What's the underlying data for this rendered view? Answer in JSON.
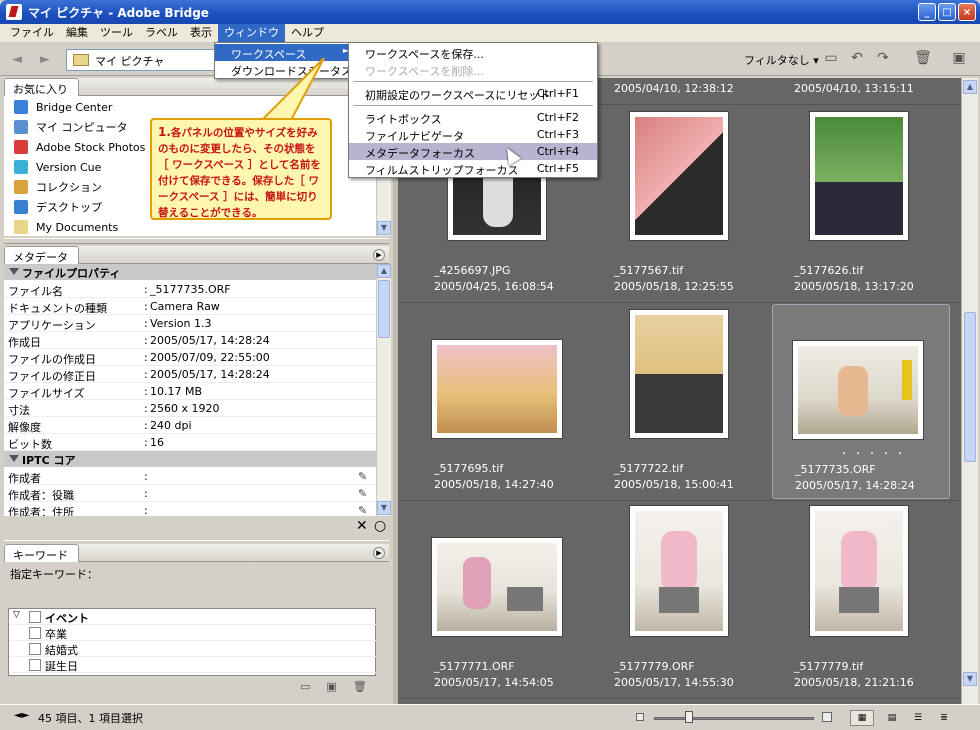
{
  "window": {
    "title": "マイ ピクチャ - Adobe Bridge",
    "min": "_",
    "max": "□",
    "close": "×"
  },
  "menubar": [
    "ファイル",
    "編集",
    "ツール",
    "ラベル",
    "表示",
    "ウィンドウ",
    "ヘルプ"
  ],
  "toolbar": {
    "back": "◄",
    "forward": "►",
    "path": "マイ ピクチャ",
    "filter": "フィルタなし"
  },
  "favorites": {
    "tab": "お気に入り",
    "items": [
      "Bridge Center",
      "マイ コンピュータ",
      "Adobe Stock Photos",
      "Version Cue",
      "コレクション",
      "デスクトップ",
      "My Documents"
    ],
    "colors": [
      "#3a7fd9",
      "#5a8fd0",
      "#d93a3a",
      "#3ab0d9",
      "#d9a23a",
      "#3a80d0",
      "#e8d48a"
    ]
  },
  "metadata": {
    "tab": "メタデータ",
    "section1": "ファイルプロパティ",
    "rows": [
      {
        "k": "ファイル名",
        "v": "_5177735.ORF"
      },
      {
        "k": "ドキュメントの種類",
        "v": "Camera Raw"
      },
      {
        "k": "アプリケーション",
        "v": "Version 1.3"
      },
      {
        "k": "作成日",
        "v": "2005/05/17, 14:28:24"
      },
      {
        "k": "ファイルの作成日",
        "v": "2005/07/09, 22:55:00"
      },
      {
        "k": "ファイルの修正日",
        "v": "2005/05/17, 14:28:24"
      },
      {
        "k": "ファイルサイズ",
        "v": "10.17 MB"
      },
      {
        "k": "寸法",
        "v": "2560 x 1920"
      },
      {
        "k": "解像度",
        "v": "240 dpi"
      },
      {
        "k": "ビット数",
        "v": "16"
      }
    ],
    "section2": "IPTC コア",
    "iptc": [
      "作成者",
      "作成者：役職",
      "作成者：住所"
    ],
    "colon": ":"
  },
  "keywords": {
    "tab": "キーワード",
    "assigned": "指定キーワード：",
    "items": [
      {
        "t": "イベント",
        "bold": true
      },
      {
        "t": "卒業",
        "bold": false
      },
      {
        "t": "結婚式",
        "bold": false
      },
      {
        "t": "誕生日",
        "bold": false
      }
    ]
  },
  "content": {
    "toprow": [
      "2005/04/10, 12:38:12",
      "2005/04/10, 13:15:11"
    ],
    "cells": [
      {
        "name": "_4256697.JPG",
        "date": "2005/04/25, 16:08:54",
        "c": [
          "#222",
          "#ddd"
        ]
      },
      {
        "name": "_5177567.tif",
        "date": "2005/05/18, 12:25:55",
        "c": [
          "#c86a6a",
          "#2a2a2a"
        ]
      },
      {
        "name": "_5177626.tif",
        "date": "2005/05/18, 13:17:20",
        "c": [
          "#4a8a3a",
          "#2a2a3a"
        ]
      },
      {
        "name": "_5177695.tif",
        "date": "2005/05/18, 14:27:40",
        "c": [
          "#e8c07a",
          "#d88aa0"
        ]
      },
      {
        "name": "_5177722.tif",
        "date": "2005/05/18, 15:00:41",
        "c": [
          "#e0c080",
          "#3a3a3a"
        ]
      },
      {
        "name": "_5177735.ORF",
        "date": "2005/05/17, 14:28:24",
        "c": [
          "#ddd8cc",
          "#e8b890"
        ]
      },
      {
        "name": "_5177771.ORF",
        "date": "2005/05/17, 14:54:05",
        "c": [
          "#e8e4dc",
          "#e0a0b8"
        ]
      },
      {
        "name": "_5177779.ORF",
        "date": "2005/05/17, 14:55:30",
        "c": [
          "#ece8e0",
          "#f0b8c8"
        ]
      },
      {
        "name": "_5177779.tif",
        "date": "2005/05/18, 21:21:16",
        "c": [
          "#ece8e0",
          "#f0b8c8"
        ]
      }
    ],
    "dots": "・・・・・"
  },
  "window_menu": {
    "items": [
      {
        "label": "ワークスペース",
        "hl": true,
        "arrow": "►"
      },
      {
        "label": "ダウンロードステータス",
        "hl": false
      }
    ]
  },
  "workspace_menu": {
    "items": [
      {
        "label": "ワークスペースを保存...",
        "sc": "",
        "dis": false
      },
      {
        "label": "ワークスペースを削除...",
        "sc": "",
        "dis": true
      },
      {
        "label": "初期設定のワークスペースにリセット",
        "sc": "Ctrl+F1",
        "dis": false
      },
      {
        "label": "ライトボックス",
        "sc": "Ctrl+F2",
        "dis": false
      },
      {
        "label": "ファイルナビゲータ",
        "sc": "Ctrl+F3",
        "dis": false
      },
      {
        "label": "メタデータフォーカス",
        "sc": "Ctrl+F4",
        "dis": false,
        "hl": true
      },
      {
        "label": "フィルムストリップフォーカス",
        "sc": "Ctrl+F5",
        "dis": false
      }
    ]
  },
  "callout": {
    "num": "1.",
    "text": "各パネルの位置やサイズを好みのものに変更したら、その状態を［ ワークスペース ］として名前を付けて保存できる。保存した［ ワークスペース ］には、簡単に切り替えることができる。"
  },
  "status": {
    "text": "45 項目、1 項目選択",
    "zoom_fraction": 0.22
  }
}
